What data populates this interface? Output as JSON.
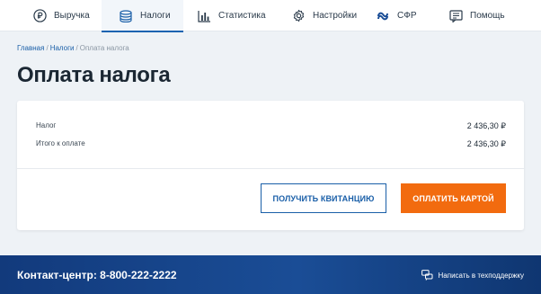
{
  "nav": {
    "items": [
      {
        "label": "Выручка",
        "icon": "ruble-circle-icon",
        "active": false
      },
      {
        "label": "Налоги",
        "icon": "coins-stack-icon",
        "active": true
      },
      {
        "label": "Статистика",
        "icon": "bar-chart-icon",
        "active": false
      },
      {
        "label": "Настройки",
        "icon": "gear-icon",
        "active": false
      },
      {
        "label": "СФР",
        "icon": "sfr-logo-icon",
        "active": false
      },
      {
        "label": "Помощь",
        "icon": "help-chat-icon",
        "active": false
      }
    ]
  },
  "breadcrumb": {
    "home": "Главная",
    "taxes": "Налоги",
    "current": "Оплата налога"
  },
  "page": {
    "title": "Оплата налога"
  },
  "summary": {
    "tax_label": "Налог",
    "tax_value": "2 436,30 ₽",
    "total_label": "Итого к оплате",
    "total_value": "2 436,30 ₽"
  },
  "actions": {
    "receipt_label": "ПОЛУЧИТЬ КВИТАНЦИЮ",
    "pay_label": "ОПЛАТИТЬ КАРТОЙ"
  },
  "footer": {
    "contact": "Контакт-центр: 8-800-222-2222",
    "support": "Написать в техподдержку"
  },
  "colors": {
    "accent": "#1a5fa8",
    "pay_button": "#f26b0f",
    "footer_bg": "#1a4d96",
    "page_bg": "#eef2f6"
  }
}
